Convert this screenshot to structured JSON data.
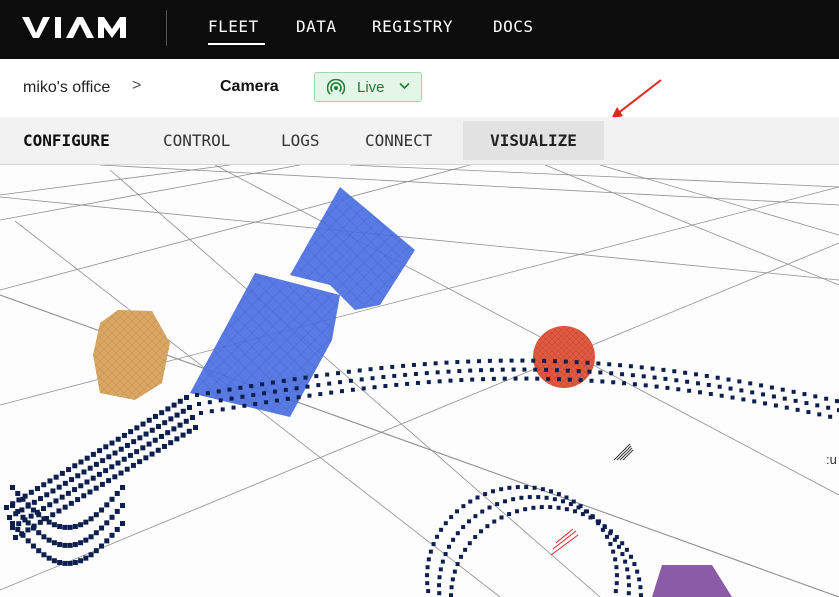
{
  "brand": {
    "logo_text": "VIAM"
  },
  "nav": {
    "items": [
      {
        "label": "FLEET",
        "active": true
      },
      {
        "label": "DATA"
      },
      {
        "label": "REGISTRY"
      },
      {
        "label": "DOCS"
      }
    ]
  },
  "breadcrumb": {
    "location": "miko's office",
    "separator": ">",
    "robot": "Camera",
    "status": {
      "label": "Live",
      "color": "#1e7e34"
    }
  },
  "tabs": {
    "items": [
      {
        "label": "CONFIGURE",
        "active": true
      },
      {
        "label": "CONTROL"
      },
      {
        "label": "LOGS"
      },
      {
        "label": "CONNECT"
      },
      {
        "label": "VISUALIZE",
        "highlighted": true
      }
    ]
  },
  "scene": {
    "edge_label": ":u",
    "colors": {
      "blue_mesh": "#4a6fe0",
      "tan_mesh": "#d9a763",
      "red_sphere": "#e05a40",
      "purple_box": "#8b5ba8",
      "points": "#0d1f4f",
      "grid": "#555555"
    }
  }
}
